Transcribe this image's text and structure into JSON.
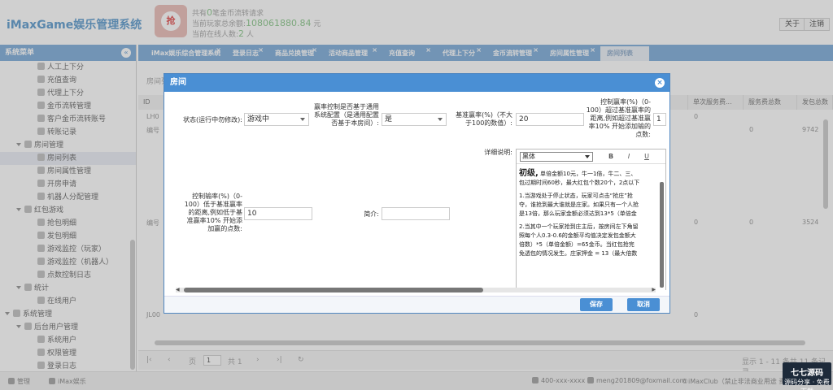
{
  "header": {
    "app_title": "iMaxGame娱乐管理系统",
    "hongbao_char": "抢",
    "stat1_prefix": "共有",
    "stat1_value": "0",
    "stat1_suffix": "笔金币流转请求",
    "stat2_prefix": "当前玩家总余额:",
    "stat2_value": "108061880.84",
    "stat2_suffix": "元",
    "stat3_prefix": "当前在线人数:",
    "stat3_value": "2",
    "stat3_suffix": "人",
    "about_label": "关于",
    "logout_label": "注销"
  },
  "sidebar": {
    "title": "系统菜单",
    "collapse_icon": "«",
    "items": [
      {
        "label": "人工上下分",
        "level": 2
      },
      {
        "label": "充值查询",
        "level": 2
      },
      {
        "label": "代理上下分",
        "level": 2
      },
      {
        "label": "金币流转管理",
        "level": 2
      },
      {
        "label": "客户金币流转账号",
        "level": 2
      },
      {
        "label": "转账记录",
        "level": 2
      },
      {
        "label": "房间管理",
        "level": 1
      },
      {
        "label": "房间列表",
        "level": 2,
        "active": true
      },
      {
        "label": "房间属性管理",
        "level": 2
      },
      {
        "label": "开房申请",
        "level": 2
      },
      {
        "label": "机器人分配管理",
        "level": 2
      },
      {
        "label": "红包游戏",
        "level": 1
      },
      {
        "label": "抢包明细",
        "level": 2
      },
      {
        "label": "发包明细",
        "level": 2
      },
      {
        "label": "游戏监控（玩家）",
        "level": 2
      },
      {
        "label": "游戏监控（机器人）",
        "level": 2
      },
      {
        "label": "点数控制日志",
        "level": 2
      },
      {
        "label": "统计",
        "level": 1
      },
      {
        "label": "在线用户",
        "level": 2
      },
      {
        "label": "系统管理",
        "level": 0
      },
      {
        "label": "后台用户管理",
        "level": 1
      },
      {
        "label": "系统用户",
        "level": 2
      },
      {
        "label": "权限管理",
        "level": 2
      },
      {
        "label": "登录日志",
        "level": 2
      }
    ]
  },
  "tabs": [
    {
      "label": "iMax娱乐综合管理系统"
    },
    {
      "label": "登录日志"
    },
    {
      "label": "商品兑换管理"
    },
    {
      "label": "活动商品管理"
    },
    {
      "label": "充值查询"
    },
    {
      "label": "代理上下分"
    },
    {
      "label": "金币流转管理"
    },
    {
      "label": "房间属性管理"
    },
    {
      "label": "房间列表",
      "active": true
    }
  ],
  "grid": {
    "title": "房间列",
    "col_id": "ID",
    "col_next_fee": "单次服务费...",
    "col_fee_total": "服务费总数",
    "col_packet_total": "发包总数",
    "row1_id": "LH0",
    "row1_label": "编号",
    "row1_next": "0",
    "row1_fee": "0",
    "row1_packets": "9742",
    "row2_label": "编号",
    "row2_next": "0",
    "row2_fee": "0",
    "row2_packets": "3524",
    "row3_id": "JL00",
    "row3_next": "0",
    "pager_page_label": "页",
    "pager_page_value": "1",
    "pager_total": "共 1",
    "pager_info": "显示 1 - 11 条共 11 条记录"
  },
  "dialog": {
    "title": "房间",
    "close_icon": "×",
    "status_label": "状态(运行中勿修改):",
    "status_value": "游戏中",
    "use_global_label": "赢率控制是否基于通用系统配置（是通用配置 否基于本房间）:",
    "use_global_value": "是",
    "base_rate_label": "基准赢率(%)（不大于100的数值）:",
    "base_rate_value": "20",
    "win_ctrl_label": "控制赢率(%)（0-100）超过基准赢率的距离,例如超过基准赢率10% 开始添加输的点数:",
    "win_ctrl_value": "1",
    "detail_label": "详细说明:",
    "lose_ctrl_label": "控制输率(%)（0-100）低于基准赢率的距离,例如低于基准赢率10% 开始添加赢的点数:",
    "lose_ctrl_value": "10",
    "intro_label": "简介:",
    "intro_value": "",
    "editor": {
      "font": "黑体",
      "bold": "B",
      "italic": "I",
      "underline": "U",
      "level_title": "初级,",
      "line1": "单倍金额10元，牛一1倍，牛二、三、",
      "line2": "包过期时间60秒，最大红包个数20个，2点以下",
      "para1_l1": "1.当游戏处于停止状态，玩家可点击“抢庄”抢",
      "para1_l2": "夺，谁抢到最大谁就是庄家。如果只有一个人抢",
      "para1_l3": "是13倍，那么玩家金额必须达到13*5（单倍金",
      "para2_l1": "2.当其中一个玩家抢到庄主后，按房间左下角留",
      "para2_l2": "照每个人0.3-0.6的金额平均值决定发包金额大",
      "para2_l3": "倍数）*5（单倍金额）=65金币。当红包抢完",
      "para2_l4": "免透包的情况发生。庄家押金 = 13（最大倍数"
    },
    "save_label": "保存",
    "cancel_label": "取消"
  },
  "footer": {
    "admin_label": "管理",
    "brand_label": "iMax娱乐",
    "phone": "400-xxx-xxxx",
    "email": "meng201809@foxmail.com",
    "copyright": "©iMaxClub（禁止非法商业用途 责任自负）"
  },
  "watermark": {
    "name": "七七源码",
    "sub": "源码分享 · 免费下载"
  }
}
